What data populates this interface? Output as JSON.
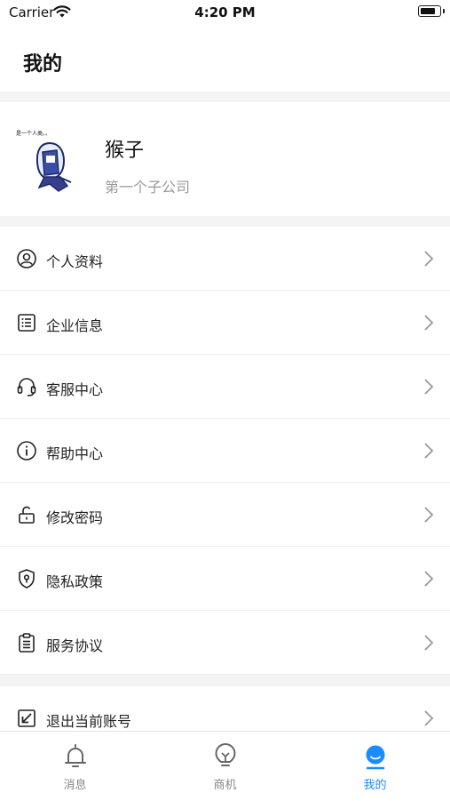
{
  "status_bar": {
    "carrier": "Carrier",
    "time": "4:20 PM"
  },
  "header": {
    "title": "我的"
  },
  "profile": {
    "avatar_icon": "avatar-image",
    "avatar_caption": "是一个人类。。",
    "name": "猴子",
    "company": "第一个子公司"
  },
  "menu": {
    "items": [
      {
        "label": "个人资料",
        "icon": "user-circle-icon"
      },
      {
        "label": "企业信息",
        "icon": "list-icon"
      },
      {
        "label": "客服中心",
        "icon": "headset-icon"
      },
      {
        "label": "帮助中心",
        "icon": "info-icon"
      },
      {
        "label": "修改密码",
        "icon": "unlock-icon"
      },
      {
        "label": "隐私政策",
        "icon": "shield-icon"
      },
      {
        "label": "服务协议",
        "icon": "clipboard-icon"
      }
    ],
    "logout": {
      "label": "退出当前账号",
      "icon": "exit-icon"
    }
  },
  "tabbar": {
    "tabs": [
      {
        "label": "消息",
        "icon": "bell-icon"
      },
      {
        "label": "商机",
        "icon": "lightbulb-icon"
      },
      {
        "label": "我的",
        "icon": "profile-icon"
      }
    ],
    "active_color": "#1a8cff",
    "inactive_color": "#888888"
  }
}
